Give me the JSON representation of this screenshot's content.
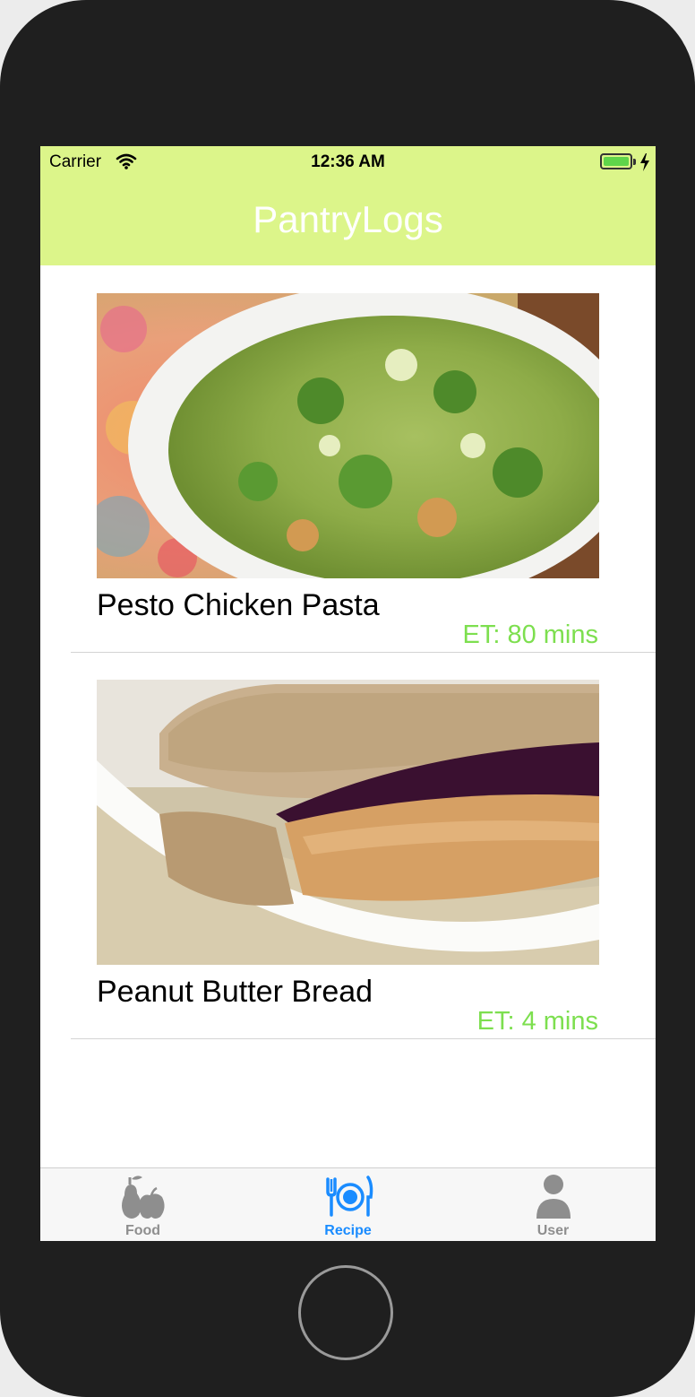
{
  "status_bar": {
    "carrier": "Carrier",
    "time": "12:36 AM"
  },
  "nav": {
    "title": "PantryLogs",
    "background_color": "#dcf58a"
  },
  "recipes": [
    {
      "name": "Pesto Chicken Pasta",
      "time": "ET: 80 mins",
      "image": "pesto-pasta-photo"
    },
    {
      "name": "Peanut Butter Bread",
      "time": "ET: 4 mins",
      "image": "pb-jelly-sandwich-photo"
    }
  ],
  "tabs": [
    {
      "label": "Food",
      "icon": "fruit-icon",
      "selected": false
    },
    {
      "label": "Recipe",
      "icon": "plate-fork-knife-icon",
      "selected": true
    },
    {
      "label": "User",
      "icon": "user-icon",
      "selected": false
    }
  ],
  "colors": {
    "accent": "#1a8cff",
    "inactive": "#8e8e8e",
    "time_text": "#7ddf4f"
  }
}
